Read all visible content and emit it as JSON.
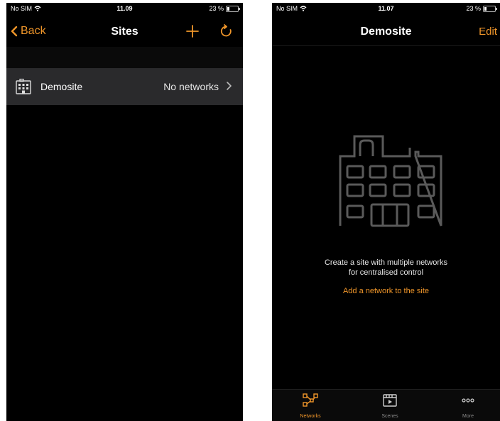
{
  "colors": {
    "accent": "#f0962a",
    "background": "#000000",
    "row": "#2a2a2c"
  },
  "left": {
    "status": {
      "carrier": "No SIM",
      "time": "11.09",
      "battery": "23 %"
    },
    "nav": {
      "back_label": "Back",
      "title": "Sites",
      "add_icon": "plus-icon",
      "refresh_icon": "refresh-icon"
    },
    "sites": [
      {
        "name": "Demosite",
        "detail": "No networks",
        "icon": "building-icon"
      }
    ]
  },
  "right": {
    "status": {
      "carrier": "No SIM",
      "time": "11.07",
      "battery": "23 %"
    },
    "nav": {
      "title": "Demosite",
      "edit_label": "Edit"
    },
    "empty": {
      "line1": "Create a site with multiple networks",
      "line2": "for centralised control",
      "action": "Add a network to the site"
    },
    "tabs": [
      {
        "label": "Networks",
        "icon": "network-icon",
        "active": true
      },
      {
        "label": "Scenes",
        "icon": "scenes-icon",
        "active": false
      },
      {
        "label": "More",
        "icon": "more-icon",
        "active": false
      }
    ]
  }
}
